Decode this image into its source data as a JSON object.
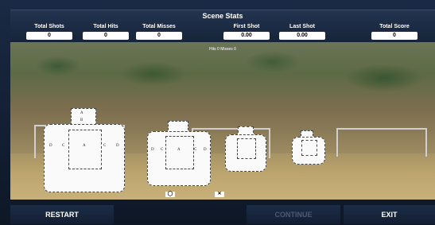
{
  "stats": {
    "title": "Scene Stats",
    "items": [
      {
        "label": "Total Shots",
        "value": "0"
      },
      {
        "label": "Total Hits",
        "value": "0"
      },
      {
        "label": "Total Misses",
        "value": "0"
      },
      {
        "label": "First Shot",
        "value": "0.00"
      },
      {
        "label": "Last Shot",
        "value": "0.00"
      },
      {
        "label": "Total Score",
        "value": "0"
      }
    ]
  },
  "scene": {
    "overlay_text": "Hits 0 Misses 0",
    "targets": [
      {
        "zones": [
          "A",
          "B",
          "C",
          "D",
          "D",
          "C",
          "A",
          "C",
          "D"
        ]
      },
      {
        "zones": [
          "A",
          "B",
          "D",
          "C",
          "A",
          "C",
          "D"
        ]
      },
      {
        "zones": [
          "A",
          "B"
        ]
      },
      {
        "zones": [
          "A",
          "B"
        ]
      }
    ],
    "icons": [
      "eye-off-icon",
      "crosshair-icon"
    ]
  },
  "footer": {
    "restart": "RESTART",
    "continue": "CONTINUE",
    "exit": "EXIT"
  }
}
